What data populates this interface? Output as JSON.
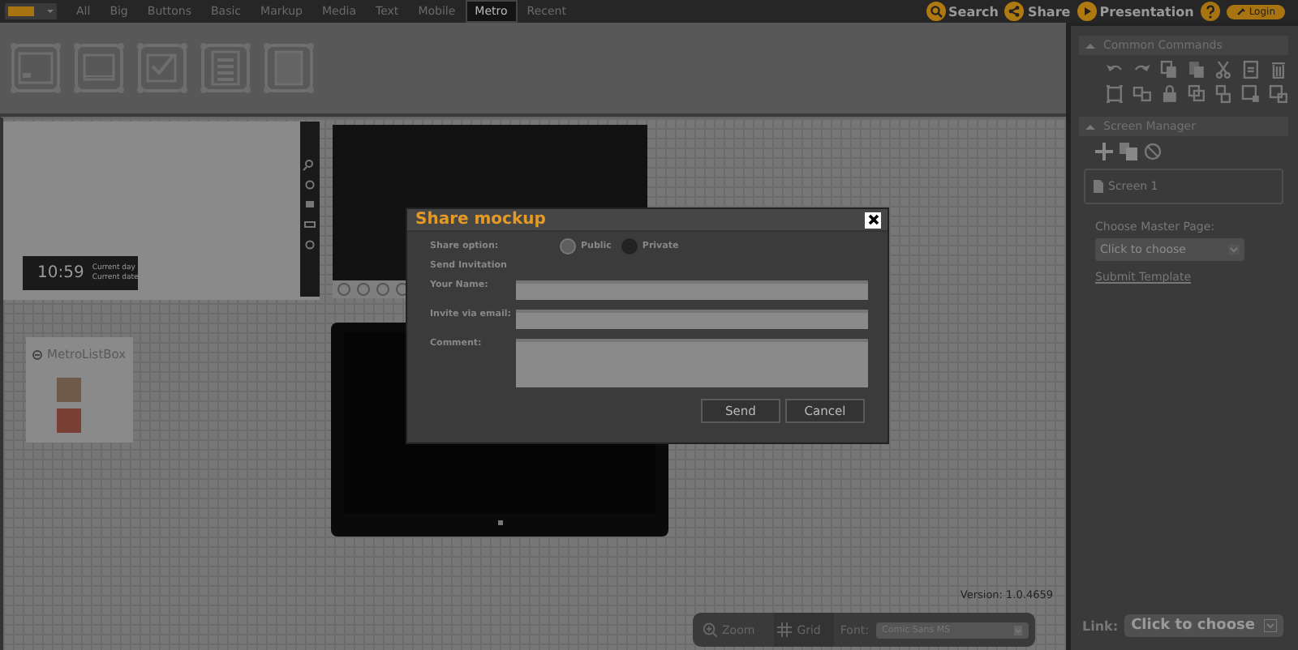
{
  "top_bar": {
    "tabs": [
      {
        "label": "All",
        "selected": false
      },
      {
        "label": "Big",
        "selected": false
      },
      {
        "label": "Buttons",
        "selected": false
      },
      {
        "label": "Basic",
        "selected": false
      },
      {
        "label": "Markup",
        "selected": false
      },
      {
        "label": "Media",
        "selected": false
      },
      {
        "label": "Text",
        "selected": false
      },
      {
        "label": "Mobile",
        "selected": false
      },
      {
        "label": "Metro",
        "selected": true
      },
      {
        "label": "Recent",
        "selected": false
      }
    ],
    "actions": [
      {
        "label": "Search",
        "kind": "search"
      },
      {
        "label": "Share",
        "kind": "share"
      },
      {
        "label": "Presentation",
        "kind": "play"
      }
    ],
    "login": "Login"
  },
  "canvas": {
    "clock": {
      "time": "10:59",
      "line_1": "Current day",
      "line_2": "Current date"
    },
    "list_box": {
      "title": "MetroListBox"
    },
    "version": "Version: 1.0.4659"
  },
  "bottom_toolbar": {
    "zoom": "Zoom",
    "grid": "Grid",
    "font_label": "Font:",
    "font_value": "Comic Sans MS"
  },
  "right_panel": {
    "common_commands": "Common Commands",
    "screen_manager": "Screen Manager",
    "screens": [
      {
        "label": "Screen 1",
        "selected": false
      }
    ],
    "master_page_label": "Choose Master Page:",
    "master_page_placeholder": "Click to choose",
    "submit_link": "Submit Template",
    "link_label": "Link:",
    "link_value": "Click to choose"
  },
  "dialog": {
    "title": "Share mockup",
    "share_option_label": "Share option:",
    "options": [
      {
        "label": "Public",
        "selected": true
      },
      {
        "label": "Private",
        "selected": false
      }
    ],
    "section": "Send Invitation",
    "fields": [
      {
        "label": "Your Name:",
        "kind": "input"
      },
      {
        "label": "Invite via email:",
        "kind": "input"
      },
      {
        "label": "Comment:",
        "kind": "textarea"
      }
    ],
    "buttons": [
      "Send",
      "Cancel"
    ]
  }
}
